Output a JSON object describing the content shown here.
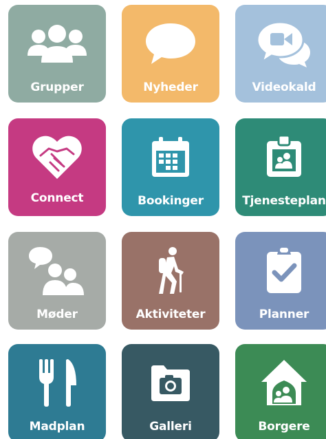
{
  "tiles": {
    "grupper": {
      "label": "Grupper",
      "icon": "group-icon",
      "color": "#8faba2"
    },
    "nyheder": {
      "label": "Nyheder",
      "icon": "speech-bubble-icon",
      "color": "#f3b96a"
    },
    "videokald": {
      "label": "Videokald",
      "icon": "video-chat-icon",
      "color": "#a4c1dc"
    },
    "connect": {
      "label": "Connect",
      "icon": "heart-handshake-icon",
      "color": "#c53a82"
    },
    "bookinger": {
      "label": "Bookinger",
      "icon": "calendar-icon",
      "color": "#2f95ab"
    },
    "tjenesteplan": {
      "label": "Tjenesteplan",
      "icon": "id-badge-icon",
      "color": "#2e8b77"
    },
    "moder": {
      "label": "Møder",
      "icon": "meeting-icon",
      "color": "#a6aba7"
    },
    "aktiviteter": {
      "label": "Aktiviteter",
      "icon": "hiker-icon",
      "color": "#997268"
    },
    "planner": {
      "label": "Planner",
      "icon": "clipboard-check-icon",
      "color": "#7b93bb"
    },
    "madplan": {
      "label": "Madplan",
      "icon": "fork-knife-icon",
      "color": "#2e7b93"
    },
    "galleri": {
      "label": "Galleri",
      "icon": "camera-folder-icon",
      "color": "#375963"
    },
    "borgere": {
      "label": "Borgere",
      "icon": "home-people-icon",
      "color": "#3c8b55"
    }
  }
}
